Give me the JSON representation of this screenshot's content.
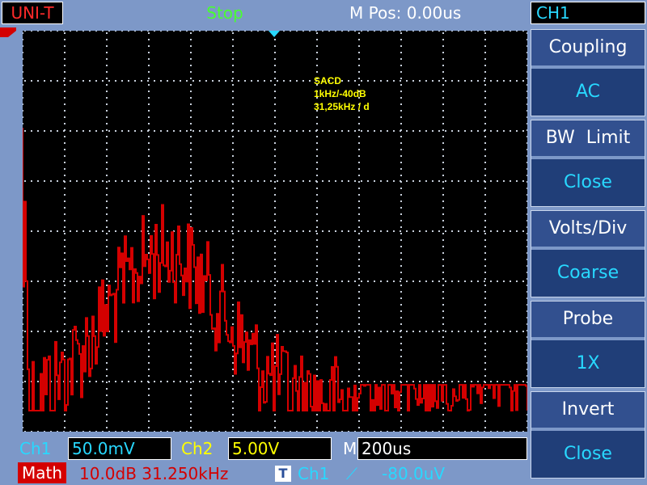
{
  "top": {
    "mode": "UNI-T",
    "run_state": "Stop",
    "mpos": "M Pos: 0.00us",
    "channel": "CH1"
  },
  "screen": {
    "annotation_lines": [
      "SACD",
      "1kHz/-40dB",
      "31,25kHz / d"
    ]
  },
  "menu": {
    "items": [
      {
        "label": "Coupling",
        "value": "AC"
      },
      {
        "label": "BW  Limit",
        "value": "Close"
      },
      {
        "label": "Volts/Div",
        "value": "Coarse"
      },
      {
        "label": "Probe",
        "value": "1X"
      },
      {
        "label": "Invert",
        "value": "Close"
      }
    ]
  },
  "bottom": {
    "ch1_label": "Ch1",
    "ch1_value": "50.0mV",
    "ch2_label": "Ch2",
    "ch2_value": "5.00V",
    "m_label": "M",
    "m_value": "200us",
    "math_label": "Math",
    "math_value": "10.0dB 31.250kHz",
    "trig_badge": "T",
    "trig_ch": "Ch1",
    "trig_slope": "⟋",
    "trig_level": "-80.0uV"
  },
  "colors": {
    "bezel": "#7d98c8",
    "trace": "#d40000",
    "ch1": "#28d8ff",
    "ch2": "#ffff00",
    "stop": "#48ff30",
    "grid_dot": "#c8d0dc"
  },
  "waveform": {
    "level_floor_div": 0.45,
    "level_peak_div": 3.2,
    "peak_position_div": 2.4
  }
}
